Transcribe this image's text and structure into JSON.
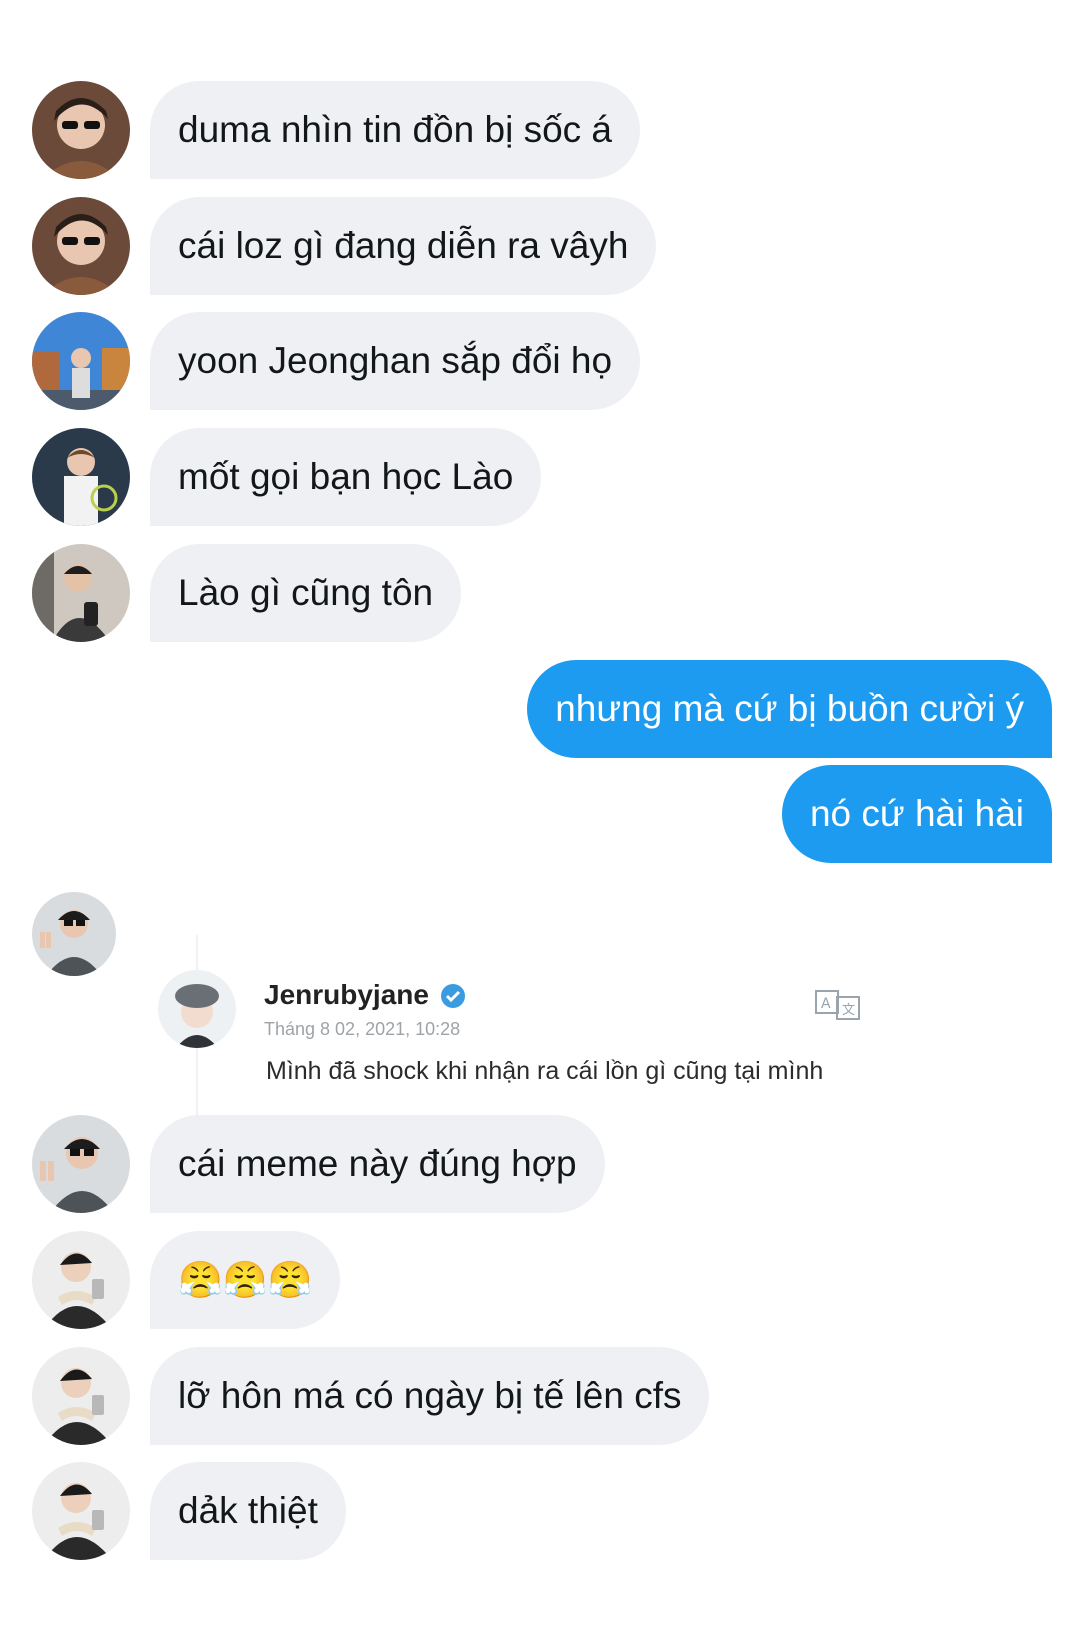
{
  "messages_in_1": [
    {
      "avatar": "avatar-glasses-man",
      "text": "duma nhìn tin đồn bị sốc á"
    },
    {
      "avatar": "avatar-glasses-man",
      "text": "cái loz gì đang diễn ra vâyh"
    },
    {
      "avatar": "avatar-city-man",
      "text": "yoon Jeonghan sắp đổi họ"
    },
    {
      "avatar": "avatar-tennis-man",
      "text": "mốt gọi bạn học Lào"
    },
    {
      "avatar": "avatar-mirror-selfie-man",
      "text": "Lào gì cũng tôn"
    }
  ],
  "messages_out": [
    {
      "text": "nhưng mà cứ bị buồn cười ý"
    },
    {
      "text": "nó cứ hài hài"
    }
  ],
  "tweet": {
    "avatar": "avatar-peace-sign-man",
    "name": "Jenrubyjane",
    "date": "Tháng 8 02, 2021, 10:28",
    "text": "Mình đã shock khi nhận ra cái lồn gì cũng tại mình",
    "verified_icon": "verified-badge-icon",
    "translate_icon": "translate-icon"
  },
  "messages_in_2": [
    {
      "avatar": "avatar-peace-sign-man",
      "text": "cái meme này đúng hợp"
    },
    {
      "avatar": "avatar-jacket-man",
      "text": "😤😤😤"
    },
    {
      "avatar": "avatar-jacket-man",
      "text": "lỡ hôn má có ngày bị tế lên cfs"
    },
    {
      "avatar": "avatar-jacket-man",
      "text": "dảk thiệt"
    }
  ],
  "colors": {
    "incoming_bubble": "#eef0f3",
    "outgoing_bubble": "#1d9bf0",
    "incoming_text": "#14171a",
    "outgoing_text": "#ffffff",
    "verified": "#1d9bf0"
  }
}
